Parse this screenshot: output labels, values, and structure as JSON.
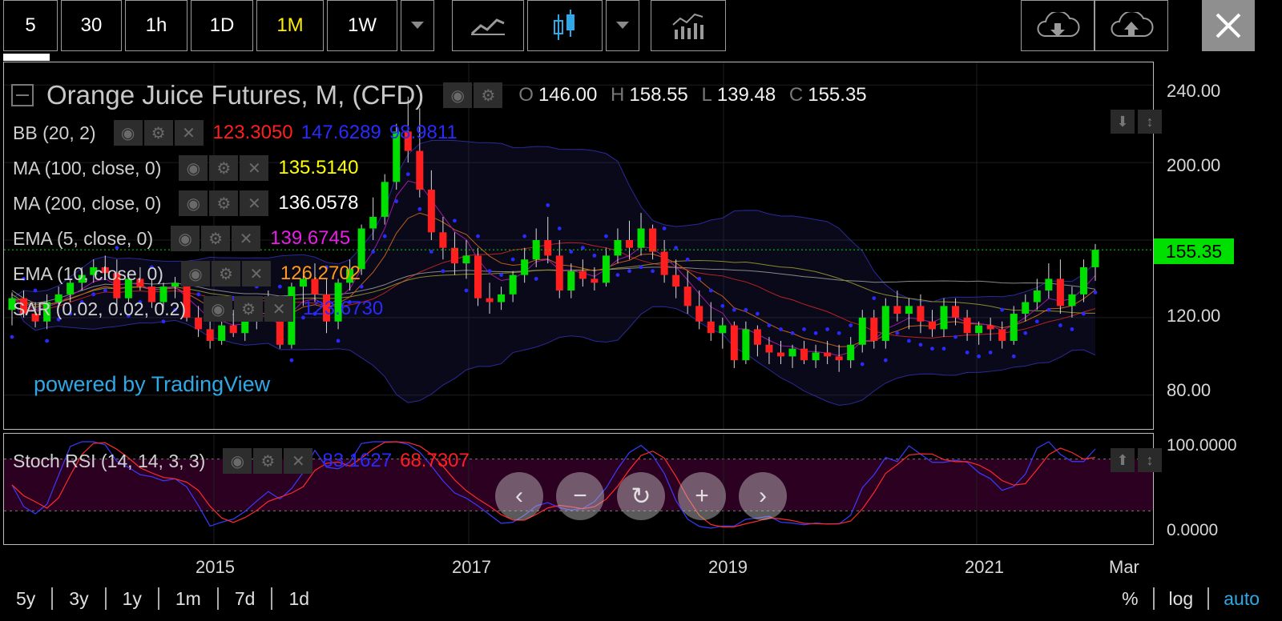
{
  "toolbar": {
    "intervals": [
      "5",
      "30",
      "1h",
      "1D",
      "1M",
      "1W"
    ],
    "active_interval": "1M",
    "active_color": "#ffee00"
  },
  "chart": {
    "symbol_title": "Orange Juice Futures, M, (CFD)",
    "ohlc": {
      "o_label": "O",
      "o": "146.00",
      "h_label": "H",
      "h": "158.55",
      "l_label": "L",
      "l": "139.48",
      "c_label": "C",
      "c": "155.35"
    },
    "indicators": [
      {
        "name": "BB (20, 2)",
        "values": [
          "123.3050",
          "147.6289",
          "98.9811"
        ],
        "colors": [
          "#ff1f1f",
          "#2a2aff",
          "#2a2aff"
        ]
      },
      {
        "name": "MA (100, close, 0)",
        "values": [
          "135.5140"
        ],
        "colors": [
          "#ffff00"
        ]
      },
      {
        "name": "MA (200, close, 0)",
        "values": [
          "136.0578"
        ],
        "colors": [
          "#ffffff"
        ]
      },
      {
        "name": "EMA (5, close, 0)",
        "values": [
          "139.6745"
        ],
        "colors": [
          "#e81ee8"
        ]
      },
      {
        "name": "EMA (10, close, 0)",
        "values": [
          "126.2702"
        ],
        "colors": [
          "#ff9a1a"
        ]
      },
      {
        "name": "SAR (0.02, 0.02, 0.2)",
        "values": [
          "123.6730"
        ],
        "colors": [
          "#2a2aff"
        ]
      }
    ],
    "powered_by": "powered by TradingView",
    "last_price": "155.35",
    "last_price_color": "#00e000",
    "price_axis": [
      "240.00",
      "200.00",
      "120.00",
      "80.00"
    ],
    "stoch": {
      "name": "Stoch RSI (14, 14, 3, 3)",
      "k": "83.1627",
      "d": "68.7307",
      "k_color": "#2a2aff",
      "d_color": "#ff1f1f",
      "axis": [
        "100.0000",
        "0.0000"
      ]
    },
    "time_axis": [
      "2015",
      "2017",
      "2019",
      "2021",
      "Mar"
    ]
  },
  "chart_data": {
    "type": "candlestick",
    "title": "Orange Juice Futures, M, (CFD)",
    "ylim": [
      70,
      250
    ],
    "candles": [
      [
        124,
        133,
        116,
        130
      ],
      [
        130,
        134,
        120,
        122
      ],
      [
        122,
        128,
        115,
        118
      ],
      [
        118,
        132,
        114,
        128
      ],
      [
        128,
        136,
        125,
        132
      ],
      [
        132,
        140,
        128,
        138
      ],
      [
        138,
        146,
        134,
        142
      ],
      [
        142,
        150,
        138,
        146
      ],
      [
        146,
        152,
        140,
        143
      ],
      [
        143,
        150,
        126,
        130
      ],
      [
        130,
        142,
        127,
        140
      ],
      [
        140,
        146,
        134,
        136
      ],
      [
        136,
        140,
        125,
        128
      ],
      [
        128,
        138,
        124,
        136
      ],
      [
        136,
        141,
        130,
        138
      ],
      [
        138,
        140,
        118,
        120
      ],
      [
        120,
        126,
        110,
        114
      ],
      [
        114,
        120,
        104,
        108
      ],
      [
        108,
        118,
        106,
        116
      ],
      [
        116,
        124,
        110,
        112
      ],
      [
        112,
        120,
        108,
        118
      ],
      [
        118,
        130,
        114,
        128
      ],
      [
        128,
        134,
        120,
        122
      ],
      [
        122,
        130,
        104,
        106
      ],
      [
        106,
        138,
        104,
        136
      ],
      [
        136,
        142,
        126,
        140
      ],
      [
        140,
        148,
        128,
        132
      ],
      [
        132,
        140,
        112,
        118
      ],
      [
        118,
        140,
        114,
        138
      ],
      [
        138,
        150,
        134,
        145
      ],
      [
        145,
        168,
        142,
        166
      ],
      [
        166,
        182,
        160,
        172
      ],
      [
        172,
        194,
        168,
        190
      ],
      [
        190,
        220,
        186,
        216
      ],
      [
        216,
        234,
        200,
        206
      ],
      [
        206,
        228,
        182,
        186
      ],
      [
        186,
        196,
        160,
        164
      ],
      [
        164,
        172,
        150,
        156
      ],
      [
        156,
        164,
        142,
        148
      ],
      [
        148,
        160,
        140,
        152
      ],
      [
        152,
        156,
        126,
        130
      ],
      [
        130,
        138,
        122,
        128
      ],
      [
        128,
        136,
        124,
        132
      ],
      [
        132,
        144,
        128,
        142
      ],
      [
        142,
        156,
        138,
        150
      ],
      [
        150,
        166,
        146,
        160
      ],
      [
        160,
        172,
        148,
        152
      ],
      [
        152,
        160,
        130,
        134
      ],
      [
        134,
        148,
        130,
        144
      ],
      [
        144,
        150,
        136,
        140
      ],
      [
        140,
        146,
        134,
        138
      ],
      [
        138,
        156,
        136,
        152
      ],
      [
        152,
        166,
        148,
        160
      ],
      [
        160,
        170,
        150,
        156
      ],
      [
        156,
        174,
        152,
        166
      ],
      [
        166,
        168,
        150,
        154
      ],
      [
        154,
        160,
        138,
        142
      ],
      [
        142,
        150,
        130,
        136
      ],
      [
        136,
        144,
        122,
        126
      ],
      [
        126,
        134,
        114,
        118
      ],
      [
        118,
        128,
        108,
        112
      ],
      [
        112,
        120,
        104,
        116
      ],
      [
        116,
        118,
        94,
        98
      ],
      [
        98,
        118,
        96,
        114
      ],
      [
        114,
        116,
        100,
        106
      ],
      [
        106,
        110,
        96,
        102
      ],
      [
        102,
        108,
        96,
        100
      ],
      [
        100,
        106,
        94,
        104
      ],
      [
        104,
        108,
        96,
        98
      ],
      [
        98,
        106,
        94,
        102
      ],
      [
        102,
        108,
        96,
        100
      ],
      [
        100,
        106,
        92,
        98
      ],
      [
        98,
        110,
        94,
        106
      ],
      [
        106,
        124,
        102,
        120
      ],
      [
        120,
        124,
        104,
        108
      ],
      [
        108,
        130,
        104,
        126
      ],
      [
        126,
        134,
        118,
        122
      ],
      [
        122,
        130,
        114,
        126
      ],
      [
        126,
        132,
        112,
        118
      ],
      [
        118,
        124,
        110,
        114
      ],
      [
        114,
        130,
        110,
        126
      ],
      [
        126,
        130,
        116,
        120
      ],
      [
        120,
        124,
        108,
        112
      ],
      [
        112,
        118,
        106,
        116
      ],
      [
        116,
        120,
        108,
        114
      ],
      [
        114,
        118,
        104,
        108
      ],
      [
        108,
        126,
        106,
        122
      ],
      [
        122,
        132,
        118,
        128
      ],
      [
        128,
        140,
        124,
        134
      ],
      [
        134,
        148,
        130,
        140
      ],
      [
        140,
        150,
        122,
        126
      ],
      [
        126,
        136,
        120,
        132
      ],
      [
        132,
        150,
        128,
        146
      ],
      [
        146,
        158,
        139,
        155
      ]
    ]
  }
}
